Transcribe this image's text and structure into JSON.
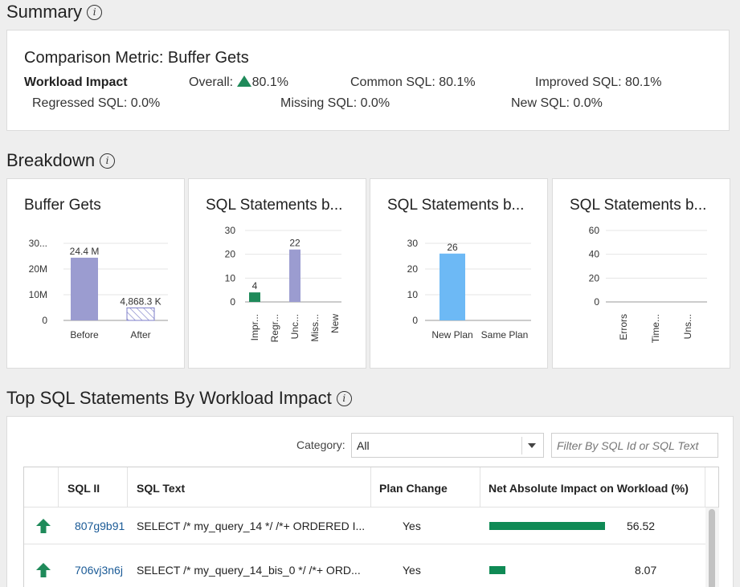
{
  "summary": {
    "heading": "Summary",
    "metric_title": "Comparison Metric: Buffer Gets",
    "workload_impact_label": "Workload Impact",
    "overall_label": "Overall:",
    "overall_value": "80.1%",
    "common_sql": "Common SQL: 80.1%",
    "improved_sql": "Improved SQL: 80.1%",
    "regressed_sql": "Regressed SQL: 0.0%",
    "missing_sql": "Missing SQL: 0.0%",
    "new_sql": "New SQL: 0.0%"
  },
  "breakdown": {
    "heading": "Breakdown"
  },
  "chart_data": [
    {
      "type": "bar",
      "title": "Buffer Gets",
      "categories": [
        "Before",
        "After"
      ],
      "values": [
        24400000,
        4868300
      ],
      "data_labels": [
        "24.4 M",
        "4,868.3 K"
      ],
      "yticks": [
        "0",
        "10M",
        "20M",
        "30..."
      ],
      "ylim": [
        0,
        30000000
      ],
      "colors": [
        "#9b9cd0",
        "hatched"
      ]
    },
    {
      "type": "bar",
      "title": "SQL Statements b...",
      "categories": [
        "Impr...",
        "Regr...",
        "Unc...",
        "Miss...",
        "New"
      ],
      "values": [
        4,
        0,
        22,
        0,
        0
      ],
      "data_labels": [
        "4",
        "",
        "22",
        "",
        ""
      ],
      "yticks": [
        "0",
        "10",
        "20",
        "30"
      ],
      "ylim": [
        0,
        30
      ],
      "colors": [
        "#1f8a5a",
        "#b3aca6"
      ]
    },
    {
      "type": "bar",
      "title": "SQL Statements b...",
      "categories": [
        "New Plan",
        "Same Plan"
      ],
      "values": [
        26,
        0
      ],
      "data_labels": [
        "26",
        ""
      ],
      "yticks": [
        "0",
        "10",
        "20",
        "30"
      ],
      "ylim": [
        0,
        30
      ],
      "colors": [
        "#6db9f5"
      ]
    },
    {
      "type": "bar",
      "title": "SQL Statements b...",
      "categories": [
        "Errors",
        "Time...",
        "Uns..."
      ],
      "values": [
        0,
        0,
        0
      ],
      "yticks": [
        "0",
        "20",
        "40",
        "60"
      ],
      "ylim": [
        0,
        60
      ]
    }
  ],
  "top_sql": {
    "heading": "Top SQL Statements By Workload Impact",
    "category_label": "Category:",
    "category_value": "All",
    "filter_placeholder": "Filter By SQL Id or SQL Text",
    "columns": [
      "SQL II",
      "SQL Text",
      "Plan Change",
      "Net Absolute Impact on Workload (%)"
    ],
    "rows": [
      {
        "sql_id": "807g9b91",
        "sql_text": "SELECT /* my_query_14 */ /*+ ORDERED I...",
        "plan_change": "Yes",
        "impact": "56.52",
        "impact_fraction": 0.5652
      },
      {
        "sql_id": "706vj3n6j",
        "sql_text": "SELECT /* my_query_14_bis_0 */ /*+ ORD...",
        "plan_change": "Yes",
        "impact": "8.07",
        "impact_fraction": 0.0807
      }
    ],
    "bar_color": "#0f8a55",
    "arrow_color": "#1f8a5a"
  }
}
